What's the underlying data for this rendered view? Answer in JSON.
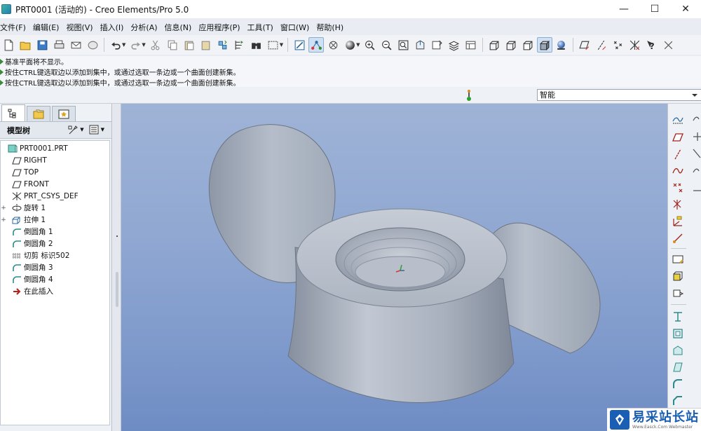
{
  "window": {
    "title": "PRT0001 (活动的) - Creo Elements/Pro 5.0",
    "minimize": "—",
    "maximize": "☐",
    "close": "✕"
  },
  "menu": [
    "文件(F)",
    "编辑(E)",
    "视图(V)",
    "插入(I)",
    "分析(A)",
    "信息(N)",
    "应用程序(P)",
    "工具(T)",
    "窗口(W)",
    "帮助(H)"
  ],
  "messages": [
    "基准平面将不显示。",
    "按住CTRL键选取边以添加到集中，或通过选取一条边或一个曲面创建新集。",
    "按住CTRL键选取边以添加到集中，或通过选取一条边或一个曲面创建新集。"
  ],
  "filter": {
    "value": "智能"
  },
  "model_tree": {
    "title": "模型树",
    "items": [
      {
        "label": "PRT0001.PRT",
        "icon": "part-icon",
        "expand": ""
      },
      {
        "label": "RIGHT",
        "icon": "datum-plane-icon",
        "expand": ""
      },
      {
        "label": "TOP",
        "icon": "datum-plane-icon",
        "expand": ""
      },
      {
        "label": "FRONT",
        "icon": "datum-plane-icon",
        "expand": ""
      },
      {
        "label": "PRT_CSYS_DEF",
        "icon": "csys-icon",
        "expand": ""
      },
      {
        "label": "旋转 1",
        "icon": "revolve-icon",
        "expand": "+"
      },
      {
        "label": "拉伸 1",
        "icon": "extrude-icon",
        "expand": "+"
      },
      {
        "label": "倒圆角 1",
        "icon": "round-icon",
        "expand": ""
      },
      {
        "label": "倒圆角 2",
        "icon": "round-icon",
        "expand": ""
      },
      {
        "label": "切剪 标识502",
        "icon": "cosmetic-thread-icon",
        "expand": ""
      },
      {
        "label": "倒圆角 3",
        "icon": "round-icon",
        "expand": ""
      },
      {
        "label": "倒圆角 4",
        "icon": "round-icon",
        "expand": ""
      },
      {
        "label": "在此插入",
        "icon": "insert-here-icon",
        "expand": ""
      }
    ]
  },
  "watermark": {
    "big": "易采站长站",
    "small": "Www.Easck.Com  Webmaster"
  }
}
